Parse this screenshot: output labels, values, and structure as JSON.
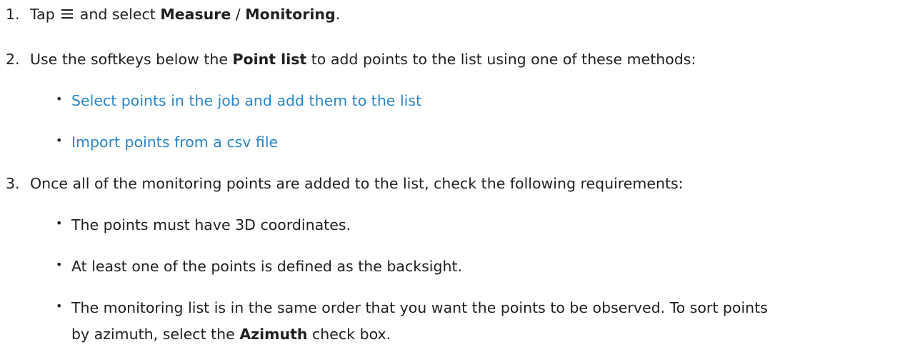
{
  "steps": [
    {
      "number": "1.",
      "parts": [
        "Tap",
        "and select",
        "Measure",
        "/",
        "Monitoring",
        "."
      ],
      "icon": "hamburger-menu-icon"
    },
    {
      "number": "2.",
      "parts": [
        "Use the softkeys below the",
        "Point list",
        "to add points to the list using one of these methods:"
      ],
      "bullets": [
        "Select points in the job and add them to the list",
        "Import points from a csv file"
      ]
    },
    {
      "number": "3.",
      "text": "Once all of the monitoring points are added to the list, check the following requirements:",
      "bullets": [
        "The points must have 3D coordinates.",
        "At least one of the points is defined as the backsight."
      ],
      "last_bullet_line1": "The monitoring list is in the same order that you want the points to be observed. To sort points",
      "last_bullet_line2_parts": [
        "by azimuth, select the",
        "Azimuth",
        "check box."
      ]
    }
  ],
  "colors": {
    "text": "#1f1f1f",
    "link": "#2a86c8"
  }
}
